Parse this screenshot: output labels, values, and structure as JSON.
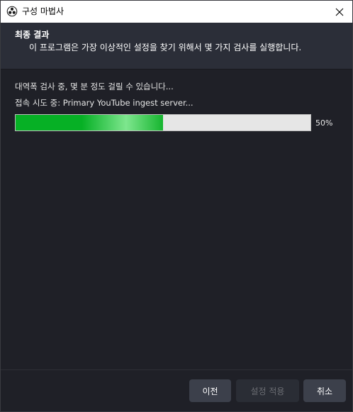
{
  "window": {
    "title": "구성 마법사",
    "app_icon": "obs-logo-icon",
    "close_icon": "close-icon"
  },
  "header": {
    "heading": "최종 결과",
    "description": "이 프로그램은 가장 이상적인 설정을 찾기 위해서 몇 가지 검사를 실행합니다."
  },
  "main": {
    "status_main": "대역폭 검사 중, 몇 분 정도 걸릴 수 있습니다...",
    "status_sub": "접속 시도 중: Primary YouTube ingest server...",
    "progress_value": 0.5,
    "progress_label": "50%"
  },
  "footer": {
    "prev_label": "이전",
    "apply_label": "설정 적용",
    "apply_enabled": false,
    "cancel_label": "취소"
  },
  "colors": {
    "background": "#1f2027",
    "header_bg": "#2b2e38",
    "progress_green": "#06b025",
    "button_bg": "#3c404b"
  }
}
